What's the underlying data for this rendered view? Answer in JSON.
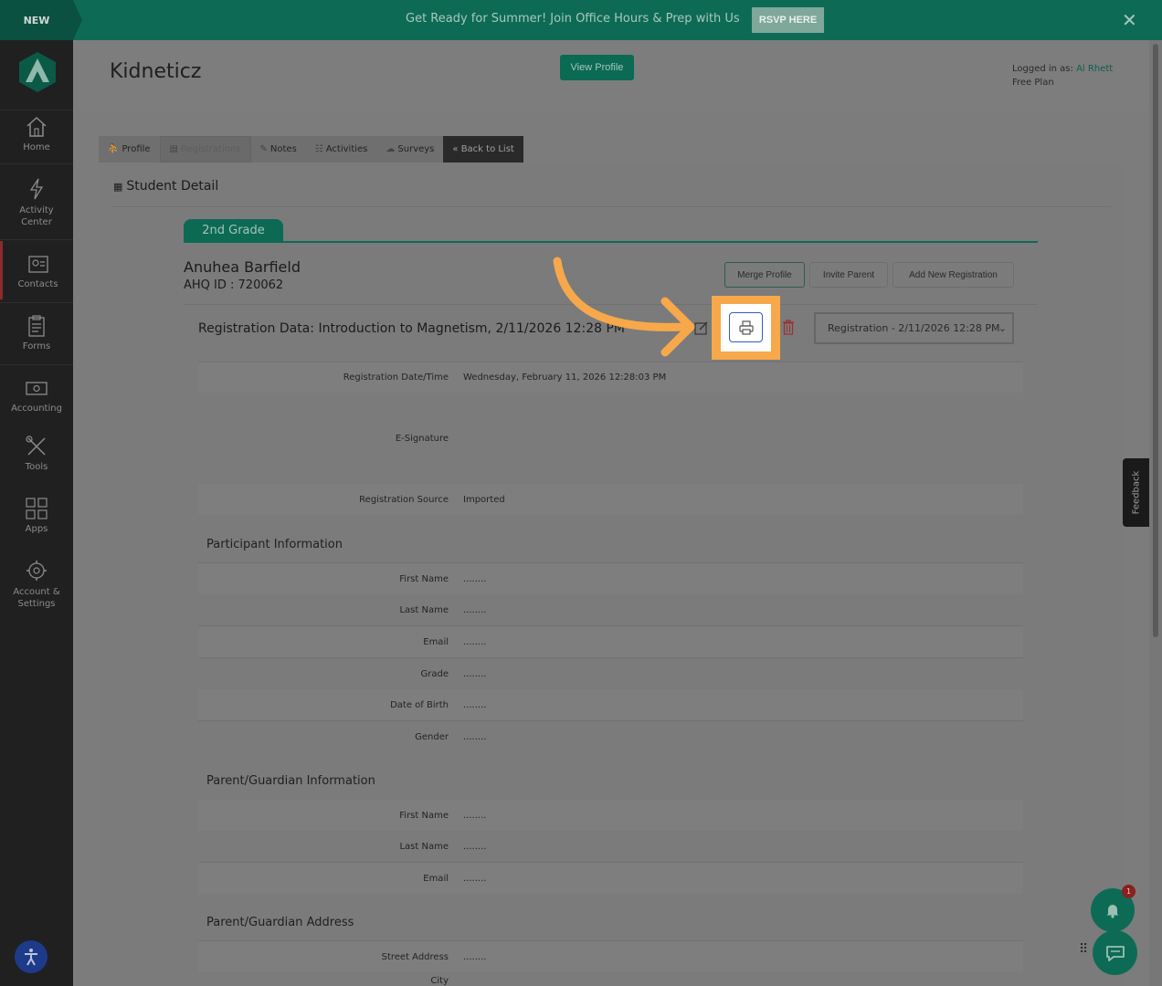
{
  "banner": {
    "badge": "NEW",
    "message": "Get Ready for Summer! Join Office Hours & Prep with Us",
    "cta": "RSVP HERE",
    "close": "✕"
  },
  "sidebar": {
    "items": [
      {
        "label": "Home"
      },
      {
        "label": "Activity Center"
      },
      {
        "label": "Contacts"
      },
      {
        "label": "Forms"
      },
      {
        "label": "Accounting"
      },
      {
        "label": "Tools"
      },
      {
        "label": "Apps"
      },
      {
        "label": "Account & Settings"
      }
    ]
  },
  "header": {
    "title": "Kidneticz",
    "view_profile": "View Profile",
    "logged_in_prefix": "Logged in as:",
    "user": "Al Rhett",
    "plan": "Free Plan"
  },
  "tabs": [
    {
      "label": "Profile",
      "icon": "person-icon"
    },
    {
      "label": "Registrations",
      "icon": "registrations-icon"
    },
    {
      "label": "Notes",
      "icon": "edit-icon"
    },
    {
      "label": "Activities",
      "icon": "activities-icon"
    },
    {
      "label": "Surveys",
      "icon": "cloud-icon"
    },
    {
      "label": "« Back to List",
      "icon": ""
    }
  ],
  "detail": {
    "title": "Student Detail",
    "grade": "2nd Grade",
    "student_name": "Anuhea Barfield",
    "student_id": "AHQ ID : 720062",
    "buttons": {
      "merge": "Merge Profile",
      "invite": "Invite Parent",
      "add_registration": "Add New Registration"
    },
    "registration_title": "Registration Data: Introduction to Magnetism, 2/11/2026 12:28 PM",
    "registration_select": "Registration - 2/11/2026 12:28 PM"
  },
  "fields_top": [
    {
      "label": "Registration Date/Time",
      "value": "Wednesday, February 11, 2026 12:28:03 PM"
    },
    {
      "label": "E-Signature",
      "value": ""
    },
    {
      "label": "Registration Source",
      "value": "Imported"
    }
  ],
  "participant": {
    "title": "Participant Information",
    "fields": [
      {
        "label": "First Name",
        "value": "........"
      },
      {
        "label": "Last Name",
        "value": "........"
      },
      {
        "label": "Email",
        "value": "........"
      },
      {
        "label": "Grade",
        "value": "........"
      },
      {
        "label": "Date of Birth",
        "value": "........"
      },
      {
        "label": "Gender",
        "value": "........"
      }
    ]
  },
  "guardian": {
    "title": "Parent/Guardian Information",
    "fields": [
      {
        "label": "First Name",
        "value": "........"
      },
      {
        "label": "Last Name",
        "value": "........"
      },
      {
        "label": "Email",
        "value": "........"
      }
    ]
  },
  "address": {
    "title": "Parent/Guardian Address",
    "fields": [
      {
        "label": "Street Address",
        "value": "........"
      },
      {
        "label": "City",
        "value": ""
      }
    ]
  },
  "widgets": {
    "feedback": "Feedback",
    "notification_count": "1"
  },
  "colors": {
    "brand": "#0d6b55",
    "highlight": "#f7a84a",
    "focus": "#2f5cc5"
  }
}
